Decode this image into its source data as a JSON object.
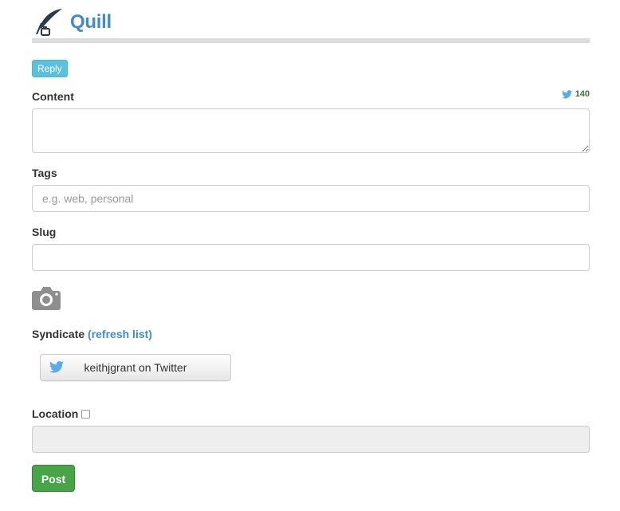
{
  "header": {
    "title": "Quill",
    "logo_icon": "quill-pen-icon"
  },
  "reply_button": {
    "label": "Reply"
  },
  "content": {
    "label": "Content",
    "char_count": "140",
    "counter_icon": "twitter-bird-icon",
    "value": ""
  },
  "tags": {
    "label": "Tags",
    "placeholder": "e.g. web, personal",
    "value": ""
  },
  "slug": {
    "label": "Slug",
    "value": ""
  },
  "photo": {
    "icon": "camera-icon"
  },
  "syndicate": {
    "label": "Syndicate",
    "refresh_label": "(refresh list)",
    "targets": [
      {
        "label": "keithjgrant on Twitter",
        "icon": "twitter-bird-icon"
      }
    ]
  },
  "location": {
    "label": "Location",
    "checked": false,
    "value": ""
  },
  "post_button": {
    "label": "Post"
  },
  "colors": {
    "brand": "#428bca",
    "info": "#5bc0de",
    "success": "#47a447",
    "twitter": "#55acee",
    "counter": "#3c763d"
  }
}
